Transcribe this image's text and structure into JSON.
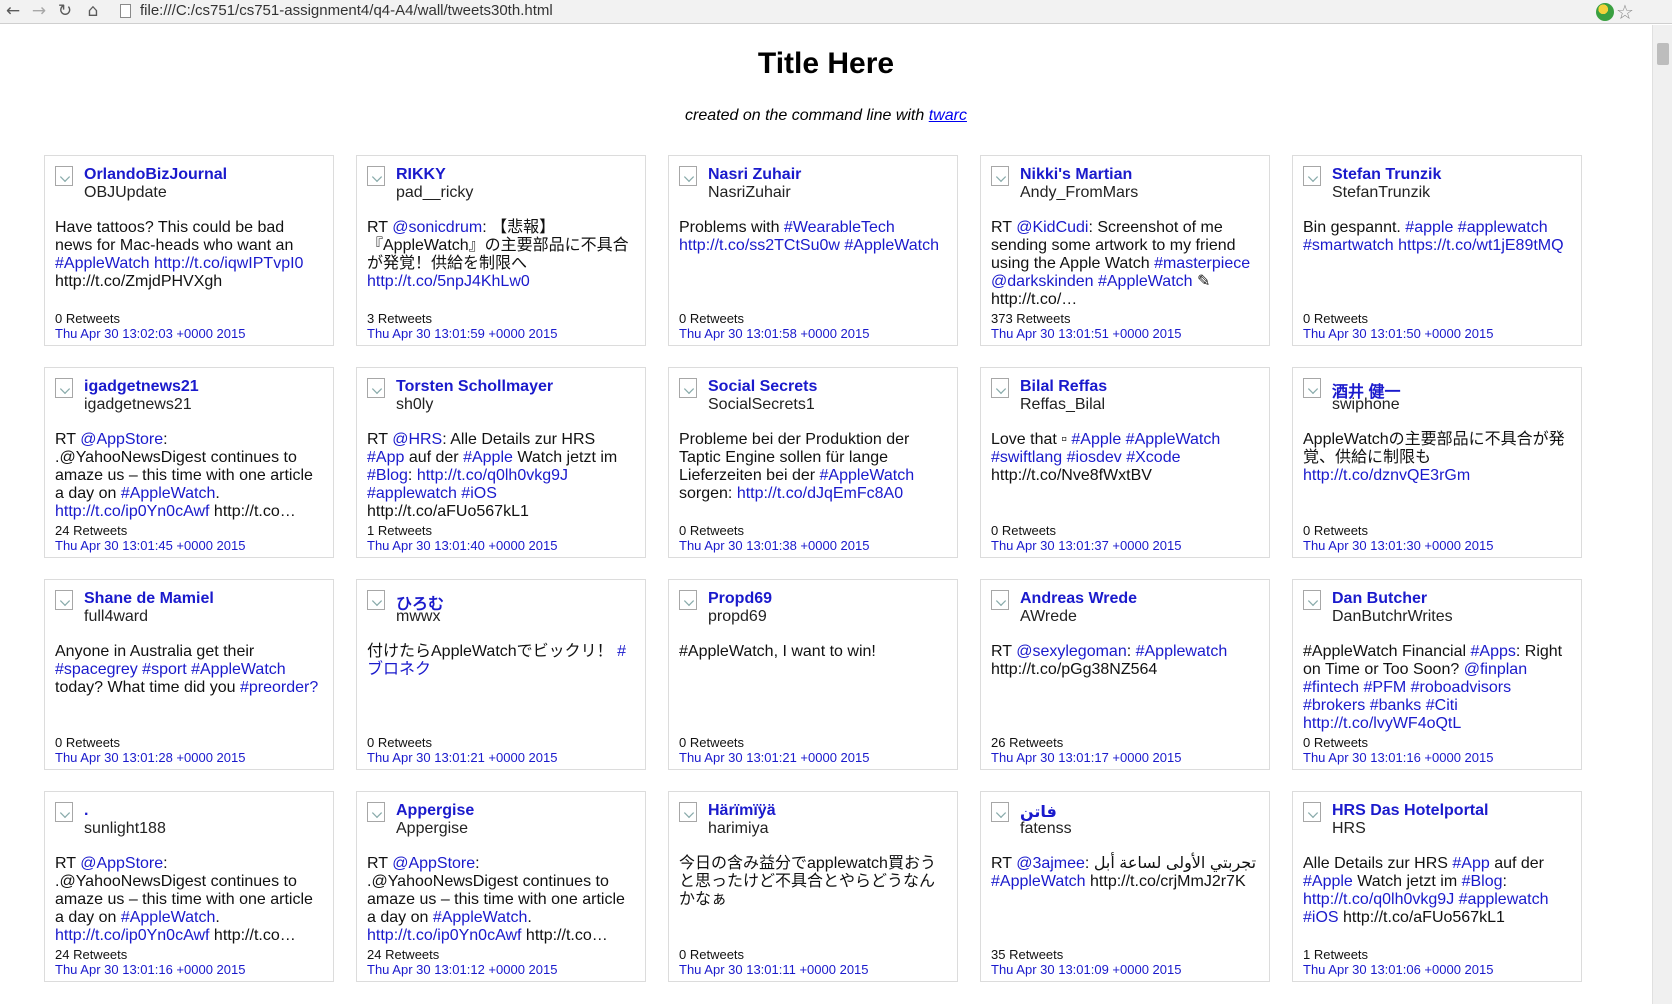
{
  "browser": {
    "back_icon": "←",
    "forward_icon": "→",
    "reload_icon": "↻",
    "home_icon": "⌂",
    "address": "file:///C:/cs751/cs751-assignment4/q4-A4/wall/tweets30th.html",
    "star_icon": "☆"
  },
  "page": {
    "title": "Title Here",
    "subtitle_prefix": "created on the command line with ",
    "subtitle_link": "twarc"
  },
  "tweets": [
    {
      "name": "OrlandoBizJournal",
      "handle": "OBJUpdate",
      "text": "Have tattoos? This could be bad news for Mac-heads who want an <span class=\"lk\">#AppleWatch</span> <span class=\"lk\">http://t.co/iqwIPTvpI0</span> http://t.co/ZmjdPHVXgh",
      "retweets": "0 Retweets",
      "date": "Thu Apr 30 13:02:03 +0000 2015"
    },
    {
      "name": "RIKKY",
      "handle": "pad__ricky",
      "text": "RT <span class=\"lk\">@sonicdrum</span>: 【悲報】『AppleWatch』の主要部品に不具合が発覚！供給を制限へ <span class=\"lk\">http://t.co/5npJ4KhLw0</span>",
      "retweets": "3 Retweets",
      "date": "Thu Apr 30 13:01:59 +0000 2015"
    },
    {
      "name": "Nasri Zuhair",
      "handle": "NasriZuhair",
      "text": "Problems with <span class=\"lk\">#WearableTech</span> <span class=\"lk\">http://t.co/ss2TCtSu0w</span> <span class=\"lk\">#AppleWatch</span>",
      "retweets": "0 Retweets",
      "date": "Thu Apr 30 13:01:58 +0000 2015"
    },
    {
      "name": "Nikki's Martian",
      "handle": "Andy_FromMars",
      "text": "RT <span class=\"lk\">@KidCudi</span>: Screenshot of me sending some artwork to my friend using the Apple Watch <span class=\"lk\">#masterpiece</span> <span class=\"lk\">@darkskinden</span> <span class=\"lk\">#AppleWatch</span> ✎ http://t.co/…",
      "retweets": "373 Retweets",
      "date": "Thu Apr 30 13:01:51 +0000 2015"
    },
    {
      "name": "Stefan Trunzik",
      "handle": "StefanTrunzik",
      "text": "Bin gespannt. <span class=\"lk\">#apple</span> <span class=\"lk\">#applewatch</span> <span class=\"lk\">#smartwatch</span> <span class=\"lk\">https://t.co/wt1jE89tMQ</span>",
      "retweets": "0 Retweets",
      "date": "Thu Apr 30 13:01:50 +0000 2015"
    },
    {
      "name": "igadgetnews21",
      "handle": "igadgetnews21",
      "text": "RT <span class=\"lk\">@AppStore</span>: .@YahooNewsDigest continues to amaze us – this time with one article a day on <span class=\"lk\">#AppleWatch</span>. <span class=\"lk\">http://t.co/ip0Yn0cAwf</span> http://t.co…",
      "retweets": "24 Retweets",
      "date": "Thu Apr 30 13:01:45 +0000 2015"
    },
    {
      "name": "Torsten Schollmayer",
      "handle": "sh0ly",
      "text": "RT <span class=\"lk\">@HRS</span>: Alle Details zur HRS <span class=\"lk\">#App</span> auf der <span class=\"lk\">#Apple</span> Watch jetzt im <span class=\"lk\">#Blog</span>: <span class=\"lk\">http://t.co/q0lh0vkg9J</span> <span class=\"lk\">#applewatch</span> <span class=\"lk\">#iOS</span> http://t.co/aFUo567kL1",
      "retweets": "1 Retweets",
      "date": "Thu Apr 30 13:01:40 +0000 2015"
    },
    {
      "name": "Social Secrets",
      "handle": "SocialSecrets1",
      "text": "Probleme bei der Produktion der Taptic Engine sollen für lange Lieferzeiten bei der <span class=\"lk\">#AppleWatch</span> sorgen: <span class=\"lk\">http://t.co/dJqEmFc8A0</span>",
      "retweets": "0 Retweets",
      "date": "Thu Apr 30 13:01:38 +0000 2015"
    },
    {
      "name": "Bilal Reffas",
      "handle": "Reffas_Bilal",
      "text": "Love that ▫ <span class=\"lk\">#Apple</span> <span class=\"lk\">#AppleWatch</span> <span class=\"lk\">#swiftlang</span> <span class=\"lk\">#iosdev</span> <span class=\"lk\">#Xcode</span> http://t.co/Nve8fWxtBV",
      "retweets": "0 Retweets",
      "date": "Thu Apr 30 13:01:37 +0000 2015"
    },
    {
      "name": "酒井 健一",
      "handle": "swiphone",
      "text": "AppleWatchの主要部品に不具合が発覚、供給に制限も <span class=\"lk\">http://t.co/dznvQE3rGm</span>",
      "retweets": "0 Retweets",
      "date": "Thu Apr 30 13:01:30 +0000 2015"
    },
    {
      "name": "Shane de Mamiel",
      "handle": "full4ward",
      "text": "Anyone in Australia get their <span class=\"lk\">#spacegrey</span> <span class=\"lk\">#sport</span> <span class=\"lk\">#AppleWatch</span> today? What time did you <span class=\"lk\">#preorder?</span>",
      "retweets": "0 Retweets",
      "date": "Thu Apr 30 13:01:28 +0000 2015"
    },
    {
      "name": "ひろむ",
      "handle": "mwwx",
      "text": "付けたらAppleWatchでビックリ！ <span class=\"lk\">#ブロネク</span>",
      "retweets": "0 Retweets",
      "date": "Thu Apr 30 13:01:21 +0000 2015"
    },
    {
      "name": "Propd69",
      "handle": "propd69",
      "text": "#AppleWatch, I want to win!",
      "retweets": "0 Retweets",
      "date": "Thu Apr 30 13:01:21 +0000 2015"
    },
    {
      "name": "Andreas Wrede",
      "handle": "AWrede",
      "text": "RT <span class=\"lk\">@sexylegoman</span>: <span class=\"lk\">#Applewatch</span> http://t.co/pGg38NZ564",
      "retweets": "26 Retweets",
      "date": "Thu Apr 30 13:01:17 +0000 2015"
    },
    {
      "name": "Dan Butcher",
      "handle": "DanButchrWrites",
      "text": "#AppleWatch Financial <span class=\"lk\">#Apps</span>: Right on Time or Too Soon? <span class=\"lk\">@finplan</span> <span class=\"lk\">#fintech</span> <span class=\"lk\">#PFM</span> <span class=\"lk\">#roboadvisors</span> <span class=\"lk\">#brokers</span> <span class=\"lk\">#banks</span> <span class=\"lk\">#Citi</span> <span class=\"lk\">http://t.co/lvyWF4oQtL</span>",
      "retweets": "0 Retweets",
      "date": "Thu Apr 30 13:01:16 +0000 2015"
    },
    {
      "name": ".",
      "handle": "sunlight188",
      "text": "RT <span class=\"lk\">@AppStore</span>: .@YahooNewsDigest continues to amaze us – this time with one article a day on <span class=\"lk\">#AppleWatch</span>. <span class=\"lk\">http://t.co/ip0Yn0cAwf</span> http://t.co…",
      "retweets": "24 Retweets",
      "date": "Thu Apr 30 13:01:16 +0000 2015"
    },
    {
      "name": "Appergise",
      "handle": "Appergise",
      "text": "RT <span class=\"lk\">@AppStore</span>: .@YahooNewsDigest continues to amaze us – this time with one article a day on <span class=\"lk\">#AppleWatch</span>. <span class=\"lk\">http://t.co/ip0Yn0cAwf</span> http://t.co…",
      "retweets": "24 Retweets",
      "date": "Thu Apr 30 13:01:12 +0000 2015"
    },
    {
      "name": "Härïmïÿä",
      "handle": "harimiya",
      "text": "今日の含み益分でapplewatch買おうと思ったけど不具合とやらどうなんかなぁ",
      "retweets": "0 Retweets",
      "date": "Thu Apr 30 13:01:11 +0000 2015"
    },
    {
      "name": "فاتن",
      "handle": "fatenss",
      "text": "RT <span class=\"lk\">@3ajmee</span>: تجربتي الأولى لساعة أبل <span class=\"lk\">#AppleWatch</span> http://t.co/crjMmJ2r7K",
      "retweets": "35 Retweets",
      "date": "Thu Apr 30 13:01:09 +0000 2015"
    },
    {
      "name": "HRS Das Hotelportal",
      "handle": "HRS",
      "text": "Alle Details zur HRS <span class=\"lk\">#App</span> auf der <span class=\"lk\">#Apple</span> Watch jetzt im <span class=\"lk\">#Blog</span>: <span class=\"lk\">http://t.co/q0lh0vkg9J</span> <span class=\"lk\">#applewatch</span> <span class=\"lk\">#iOS</span> http://t.co/aFUo567kL1",
      "retweets": "1 Retweets",
      "date": "Thu Apr 30 13:01:06 +0000 2015"
    }
  ]
}
